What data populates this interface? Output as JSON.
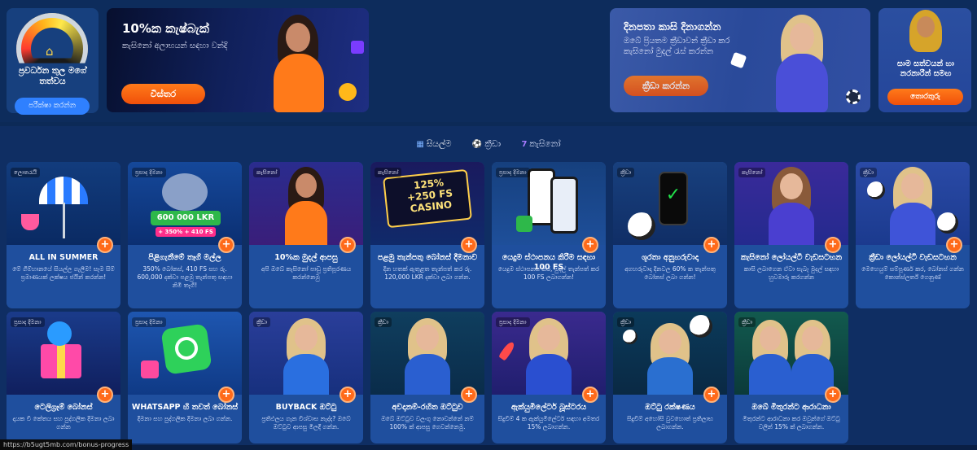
{
  "progress_card": {
    "title": "ප්‍රවර්ධන තුල මගේ තත්වය",
    "button": "පරීක්ෂා කරන්න"
  },
  "cashback_banner": {
    "title": "10%ක කැෂ්බැක්",
    "subtitle": "කැසිනෝ අලාභයන් සඳහා වන්දි",
    "button": "විස්තර"
  },
  "daily_banner": {
    "title": "දිනපතා කාසි දිනාගන්න",
    "subtitle": "ඔබේ ප්‍රියතම ක්‍රීඩාවන් ක්‍රීඩා කර කැසිනෝ මුදල් රැස් කරන්න",
    "button": "ක්‍රීඩා කරන්න"
  },
  "pharaoh_banner": {
    "subtitle": "සාම සත්වයන් හා නරනාරීන් සමඟ",
    "button": "තොරතුරු"
  },
  "tabs": [
    {
      "label": "සියල්ම",
      "icon": "grid-icon"
    },
    {
      "label": "ක්‍රීඩා",
      "icon": "ball-icon"
    },
    {
      "label": "කැසිනෝ",
      "icon": "seven-icon"
    }
  ],
  "promos": [
    {
      "badge": "ලොතරැයි",
      "title": "ALL IN SUMMER",
      "desc": "මේ ගිම්හානයේ සියල්ල ගැලීම! සෑම සිම් ප්‍රමාණයක් ලක්ෂය ජයින් කරන්න!"
    },
    {
      "badge": "ප්‍රසාද දීමනා",
      "title": "පිළිගැනීමේ තෑගි මල්ල",
      "desc": "350% බෝනස්, 410 FS සහ රු. 600,000 දක්වා පළමු තැන්පතු සඳහා නිමි තෑගි!"
    },
    {
      "badge": "කැසිනෝ",
      "title": "10%ක මුදල් ආපසු",
      "desc": "අපි ඔබේ කැසිනෝ පාඩු ප්‍රතිපූරණය කරන්නෙමු"
    },
    {
      "badge": "කැසිනෝ",
      "title": "පළමු තැන්පතු බෝනස් දීමනාව",
      "desc": "දින හතක් ඇතුළත තැන්පත් කර රු. 120,000 LKR දක්වා ලබා ගන්න."
    },
    {
      "badge": "ප්‍රසාද දීමනා",
      "title": "යෙදුම ස්ථාපනය කිරීම සඳහා 100 FS",
      "desc": "යෙදුම ස්ථාපනය කර, මුදල් තැන්පත් කර 100 FS ලබාගන්න!"
    },
    {
      "badge": "ක්‍රීඩා",
      "title": "ශූරතා අනුහරුවාදා",
      "desc": "අගහරුවාදා දිනවල 60% ක තැන්පතු බෝනස් ලබා ගන්න!"
    },
    {
      "badge": "කැසිනෝ",
      "title": "කැසිනෝ ලෝයල්ටි වැඩසටහන",
      "desc": "කාසි ලබාගෙන ඒවා සැබෑ මුදල් සඳහා හුවමාරු කරගන්න"
    },
    {
      "badge": "ක්‍රීඩා",
      "title": "ක්‍රීඩා ලෝයල්ටි වැඩසටහන",
      "desc": "මෙහෙයුම් සම්පූර්ණ කර, බෝනස් ගන්න කොන්ස්ලර්ත් ගෙනුණ්"
    },
    {
      "badge": "ප්‍රසාද දීමනා",
      "title": "ටෙලිග්‍රෑම් බෝනස්",
      "desc": "දායක වී කේතය සහ පුද්ගලික දීමනා ලබා ගන්න"
    },
    {
      "badge": "ප්‍රසාද දීමනා",
      "title": "WHATSAPP හි තවත් බෝනස්",
      "desc": "දීමනා සහ පුද්ගලික දීමනා ලබා ගන්න."
    },
    {
      "badge": "ක්‍රීඩා",
      "title": "BUYBACK ඔට්ටු",
      "desc": "ප්‍රතිඵලය ගැන විශ්වාස නැද්ද? ඔබේ ඔට්ටුව ආපසු මිලදී ගන්න."
    },
    {
      "badge": "ක්‍රීඩා",
      "title": "අවදානම්-රහිත ඔට්ටුව",
      "desc": "ඔබේ ඔට්ටුව වලංගු නොවන්නේ නම් 100% ක් ආපසු ගෙවන්නෙමු."
    },
    {
      "badge": "ප්‍රසාද දීමනා",
      "title": "ඇක්යුමිලේටර් බූස්ටරය",
      "desc": "සිදුවීම් 4 ක ඇක්යුමිලේටර් සඳහා අමතර 15% ලබාගන්න."
    },
    {
      "badge": "ක්‍රීඩා",
      "title": "ඔට්ටු රක්ෂණය",
      "desc": "සිදුවීම් අහෝසි වුවහොත් ප්‍රතිලාභ ලබාගන්න."
    },
    {
      "badge": "ක්‍රීඩා",
      "title": "ඔබේ මිතුරන්ට ආරාධනා",
      "desc": "මිතුරන්ට ආරාධනා කර ඔවුන්ගේ ඔට්ටු වලින් 15% ක් ලබාගන්න."
    }
  ],
  "status_url": "https://b5ugt5mb.com/bonus-progress",
  "colors": {
    "accent_orange": "#ff6a1a",
    "accent_blue": "#2f80ff",
    "page_bg": "#0c2a57",
    "card_bg": "#1f4f9e"
  }
}
